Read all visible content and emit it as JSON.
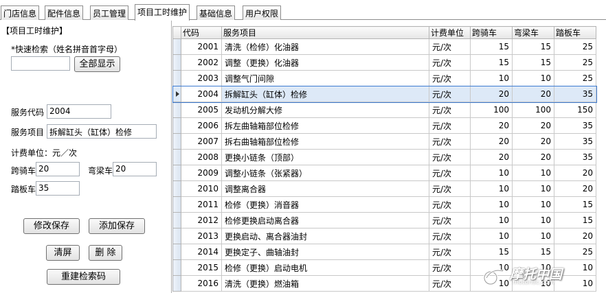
{
  "tabs": [
    {
      "label": "门店信息"
    },
    {
      "label": "配件信息"
    },
    {
      "label": "员工管理"
    },
    {
      "label": "项目工时维护"
    },
    {
      "label": "基础信息"
    },
    {
      "label": "用户权限"
    }
  ],
  "active_tab": 3,
  "panel": {
    "title": "【项目工时维护】",
    "quick_search_label": "*快速检索（姓名拼音首字母）",
    "search_value": "",
    "show_all_button": "全部显示",
    "code_label": "服务代码",
    "code_value": "2004",
    "item_label": "服务项目",
    "item_value": "拆解缸头（缸体）检修",
    "unit_label": "计费单位：元／次",
    "kuaqi_label": "跨骑车",
    "kuaqi_value": "20",
    "wanliang_label": "弯梁车",
    "wanliang_value": "20",
    "taban_label": "踏板车",
    "taban_value": "35",
    "save_edit_button": "修改保存",
    "save_add_button": "添加保存",
    "clear_button": "清屏",
    "delete_button": "删 除",
    "rebuild_button": "重建检索码"
  },
  "grid": {
    "columns": [
      "代码",
      "服务项目",
      "计费单位",
      "跨骑车",
      "弯梁车",
      "踏板车"
    ],
    "selected_row": 3,
    "rows": [
      {
        "code": "2001",
        "item": "清洗（检修）化油器",
        "unit": "元/次",
        "kuaqi": "15",
        "wanliang": "15",
        "taban": "25"
      },
      {
        "code": "2002",
        "item": "调整（更换）化油器",
        "unit": "元/次",
        "kuaqi": "15",
        "wanliang": "15",
        "taban": "25"
      },
      {
        "code": "2003",
        "item": "调整气门间隙",
        "unit": "元/次",
        "kuaqi": "10",
        "wanliang": "10",
        "taban": "25"
      },
      {
        "code": "2004",
        "item": "拆解缸头（缸体）检修",
        "unit": "元/次",
        "kuaqi": "20",
        "wanliang": "20",
        "taban": "35"
      },
      {
        "code": "2005",
        "item": "发动机分解大修",
        "unit": "元/次",
        "kuaqi": "100",
        "wanliang": "100",
        "taban": "150"
      },
      {
        "code": "2006",
        "item": "拆左曲轴箱部位检修",
        "unit": "元/次",
        "kuaqi": "20",
        "wanliang": "20",
        "taban": "35"
      },
      {
        "code": "2007",
        "item": "拆右曲轴箱部位检修",
        "unit": "元/次",
        "kuaqi": "20",
        "wanliang": "20",
        "taban": "35"
      },
      {
        "code": "2008",
        "item": "更换小链条（顶部）",
        "unit": "元/次",
        "kuaqi": "20",
        "wanliang": "20",
        "taban": "35"
      },
      {
        "code": "2009",
        "item": "调整小链条（张紧器）",
        "unit": "元/次",
        "kuaqi": "10",
        "wanliang": "10",
        "taban": "20"
      },
      {
        "code": "2010",
        "item": "调整离合器",
        "unit": "元/次",
        "kuaqi": "10",
        "wanliang": "10",
        "taban": "20"
      },
      {
        "code": "2011",
        "item": "检修（更换）消音器",
        "unit": "元/次",
        "kuaqi": "10",
        "wanliang": "10",
        "taban": "15"
      },
      {
        "code": "2012",
        "item": "检修更换启动离合器",
        "unit": "元/次",
        "kuaqi": "10",
        "wanliang": "10",
        "taban": "15"
      },
      {
        "code": "2013",
        "item": "更换启动、离合器油封",
        "unit": "元/次",
        "kuaqi": "10",
        "wanliang": "10",
        "taban": "20"
      },
      {
        "code": "2014",
        "item": "更换定子、曲轴油封",
        "unit": "元/次",
        "kuaqi": "15",
        "wanliang": "15",
        "taban": "25"
      },
      {
        "code": "2015",
        "item": "检修（更换）启动电机",
        "unit": "元/次",
        "kuaqi": "10",
        "wanliang": "10",
        "taban": "10"
      },
      {
        "code": "2016",
        "item": "清洗（更换）燃油箱",
        "unit": "元/次",
        "kuaqi": "10",
        "wanliang": "10",
        "taban": "10"
      }
    ]
  },
  "watermark": {
    "main": "摩托中国",
    "sub": "motorisc.com"
  },
  "colors": {
    "selection": "#dde9f7",
    "selection_border": "#3d7bd1"
  }
}
